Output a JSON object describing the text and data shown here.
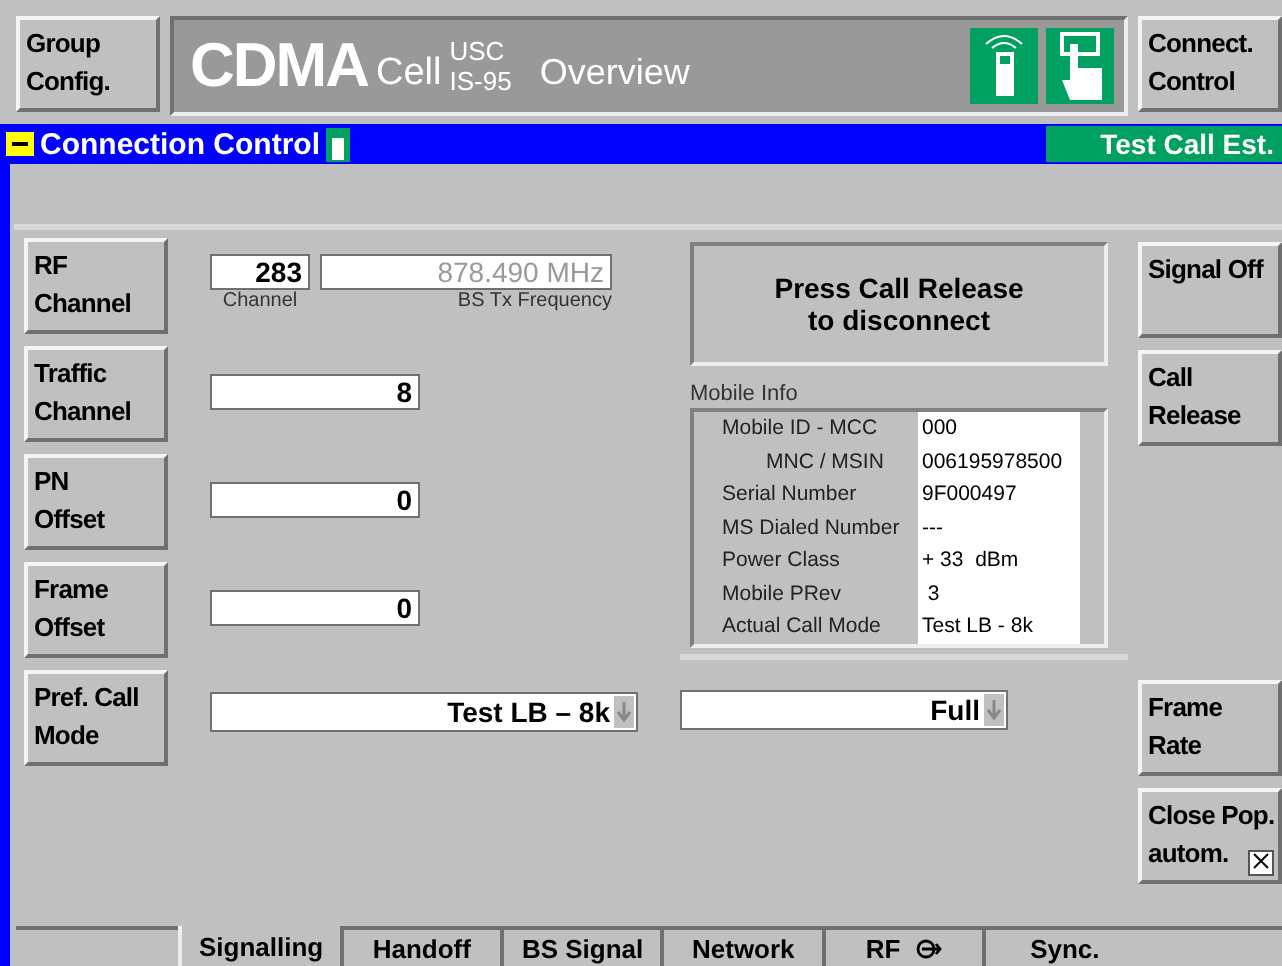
{
  "top_bar": {
    "left_button": [
      "Group",
      "Config."
    ],
    "title": {
      "system": "CDMA",
      "cell": "Cell",
      "band_top": "USC",
      "band_bottom": "IS-95",
      "view": "Overview"
    },
    "right_button": [
      "Connect.",
      "Control"
    ]
  },
  "header": {
    "title": "Connection Control",
    "status": "Test Call Est."
  },
  "params": [
    {
      "kind": "dual",
      "label": [
        "RF",
        "Channel"
      ],
      "value": "283",
      "value_caption": "Channel",
      "second_value": "878.490 MHz",
      "second_caption": "BS Tx Frequency",
      "second_disabled": true
    },
    {
      "kind": "number",
      "label": [
        "Traffic",
        "Channel"
      ],
      "value": "8"
    },
    {
      "kind": "number",
      "label": [
        "PN",
        "Offset"
      ],
      "value": "0"
    },
    {
      "kind": "number",
      "label": [
        "Frame",
        "Offset"
      ],
      "value": "0"
    },
    {
      "kind": "select",
      "label": [
        "Pref. Call",
        "Mode"
      ],
      "value": "Test LB – 8k"
    }
  ],
  "notice": [
    "Press Call Release",
    "to disconnect"
  ],
  "mobile_info": {
    "title": "Mobile Info",
    "rows": [
      {
        "label": "Mobile ID - MCC",
        "value": "000",
        "indented": false
      },
      {
        "label": "MNC / MSIN",
        "value": "006195978500",
        "indented": true
      },
      {
        "label": "Serial Number",
        "value": "9F000497",
        "indented": false
      },
      {
        "label": "MS Dialed Number",
        "value": "---",
        "indented": false
      },
      {
        "label": "Power Class",
        "value": "+ 33  dBm",
        "indented": false
      },
      {
        "label": "Mobile PRev",
        "value": " 3",
        "indented": false
      },
      {
        "label": "Actual Call Mode",
        "value": "Test LB - 8k",
        "indented": false
      }
    ]
  },
  "frame_rate": {
    "value": "Full"
  },
  "right_buttons": [
    {
      "label": [
        "Signal Off"
      ]
    },
    {
      "label": [
        "Call",
        "Release"
      ]
    }
  ],
  "frame_rate_button": [
    "Frame",
    "Rate"
  ],
  "close_popup": {
    "label": [
      "Close Pop.",
      "autom."
    ],
    "checked": true
  },
  "tabs": [
    {
      "label": "Signalling",
      "selected": true
    },
    {
      "label": "Handoff",
      "selected": false
    },
    {
      "label": "BS Signal",
      "selected": false
    },
    {
      "label": "Network",
      "selected": false
    },
    {
      "label": "RF",
      "selected": false
    },
    {
      "label": "Sync.",
      "selected": false
    }
  ]
}
